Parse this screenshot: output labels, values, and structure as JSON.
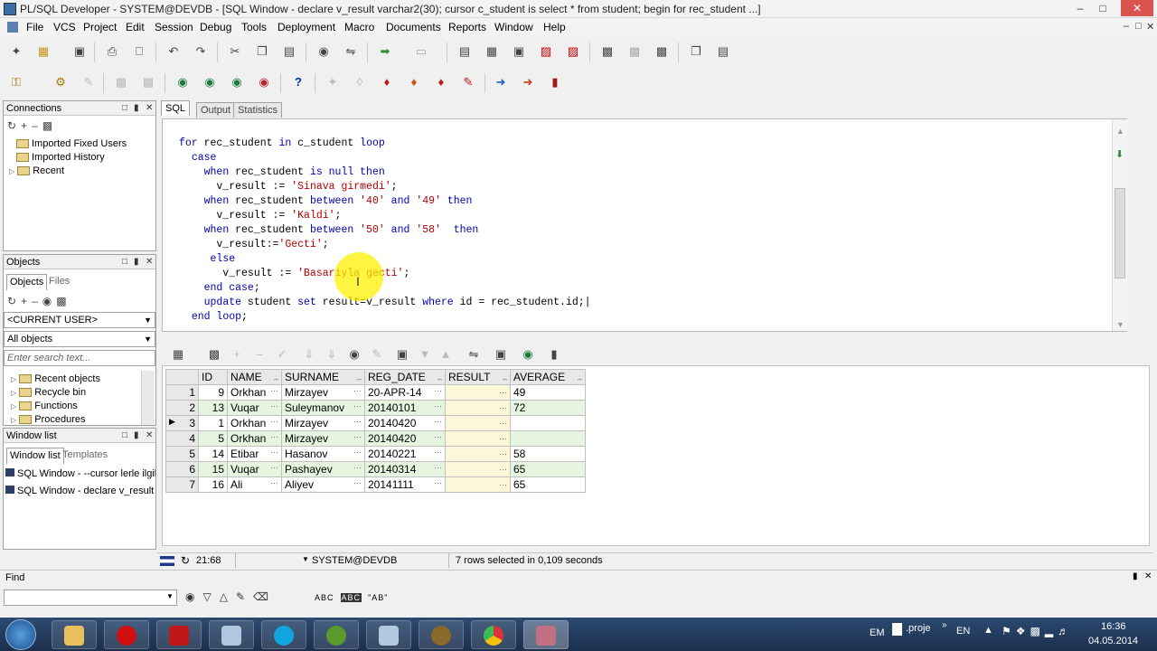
{
  "window": {
    "title": "PL/SQL Developer - SYSTEM@DEVDB - [SQL Window - declare v_result varchar2(30); cursor c_student is select * from student; begin for rec_student ...]"
  },
  "menu": [
    "File",
    "VCS",
    "Project",
    "Edit",
    "Session",
    "Debug",
    "Tools",
    "Deployment",
    "Macro",
    "Documents",
    "Reports",
    "Window",
    "Help"
  ],
  "connections": {
    "title": "Connections",
    "items": [
      "Imported Fixed Users",
      "Imported History",
      "Recent"
    ]
  },
  "objects": {
    "title": "Objects",
    "tabs": [
      "Objects",
      "Files"
    ],
    "user_combo": "<CURRENT USER>",
    "filter_combo": "All objects",
    "search_placeholder": "Enter search text...",
    "items": [
      "Recent objects",
      "Recycle bin",
      "Functions",
      "Procedures"
    ]
  },
  "window_list": {
    "title": "Window list",
    "tabs": [
      "Window list",
      "Templates"
    ],
    "items": [
      "SQL Window - --cursor lerle ilgili bir",
      "SQL Window - declare v_result var"
    ]
  },
  "editor": {
    "tabs": [
      "SQL",
      "Output",
      "Statistics"
    ],
    "lines": [
      "for rec_student in c_student loop",
      "  case",
      "    when rec_student is null then",
      "      v_result := 'Sinava girmedi';",
      "    when rec_student between '40' and '49' then",
      "      v_result := 'Kaldi';",
      "    when rec_student between '50' and '58'  then",
      "      v_result:='Gecti';",
      "     else",
      "       v_result := 'Basariyla gecti';",
      "    end case;",
      "    update student set result=v_result where id = rec_student.id;",
      "  end loop;"
    ]
  },
  "grid": {
    "columns": [
      "",
      "ID",
      "NAME",
      "SURNAME",
      "REG_DATE",
      "RESULT",
      "AVERAGE"
    ],
    "rows": [
      [
        "1",
        "9",
        "Orkhan",
        "Mirzayev",
        "20-APR-14",
        "",
        "49"
      ],
      [
        "2",
        "13",
        "Vuqar",
        "Suleymanov",
        "20140101",
        "",
        "72"
      ],
      [
        "3",
        "1",
        "Orkhan",
        "Mirzayev",
        "20140420",
        "",
        ""
      ],
      [
        "4",
        "5",
        "Orkhan",
        "Mirzayev",
        "20140420",
        "",
        ""
      ],
      [
        "5",
        "14",
        "Etibar",
        "Hasanov",
        "20140221",
        "",
        "58"
      ],
      [
        "6",
        "15",
        "Vuqar",
        "Pashayev",
        "20140314",
        "",
        "65"
      ],
      [
        "7",
        "16",
        "Ali",
        "Aliyev",
        "20141111",
        "",
        "65"
      ]
    ],
    "current_row": 3
  },
  "status": {
    "position": "21:68",
    "connection": "SYSTEM@DEVDB",
    "message": "7 rows selected in 0,109 seconds"
  },
  "find": {
    "title": "Find",
    "input_value": ""
  },
  "taskbar": {
    "lang1": "EM",
    "doc": ".proje",
    "lang2": "EN",
    "time": "16:36",
    "date": "04.05.2014"
  },
  "colors": {
    "keyword": "#0000b0",
    "string": "#b00000",
    "grid_even_row": "#e6f5e0",
    "result_col": "#fdf7d9"
  }
}
